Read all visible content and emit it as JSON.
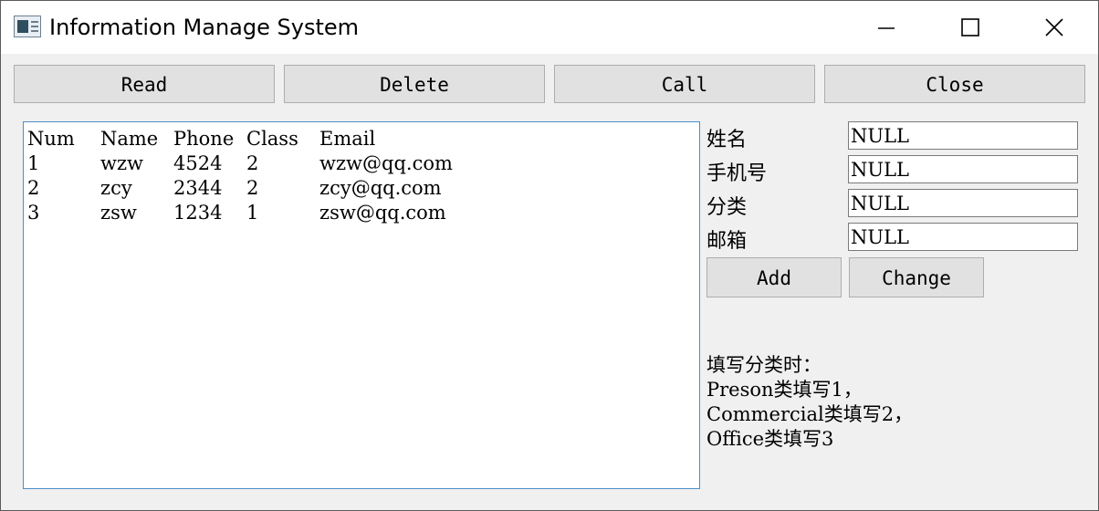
{
  "window": {
    "title": "Information Manage System"
  },
  "toolbar": {
    "read": "Read",
    "delete": "Delete",
    "call": "Call",
    "close": "Close"
  },
  "list": {
    "headers": [
      "Num",
      "Name",
      "Phone",
      "Class",
      "Email"
    ],
    "rows": [
      [
        "1",
        "wzw",
        "4524",
        "2",
        "wzw@qq.com"
      ],
      [
        "2",
        "zcy",
        "2344",
        "2",
        "zcy@qq.com"
      ],
      [
        "3",
        "zsw",
        "1234",
        "1",
        "zsw@qq.com"
      ]
    ]
  },
  "form": {
    "name_label": "姓名",
    "phone_label": "手机号",
    "class_label": "分类",
    "email_label": "邮箱",
    "name_value": "NULL",
    "phone_value": "NULL",
    "class_value": "NULL",
    "email_value": "NULL",
    "add": "Add",
    "change": "Change"
  },
  "hint": {
    "line1": "填写分类时：",
    "line2": "Preson类填写1，",
    "line3": "Commercial类填写2，",
    "line4": "Office类填写3"
  },
  "colors": {
    "list_border": "#4a90c8",
    "button_bg": "#e1e1e1",
    "window_bg": "#f0f0f0"
  }
}
